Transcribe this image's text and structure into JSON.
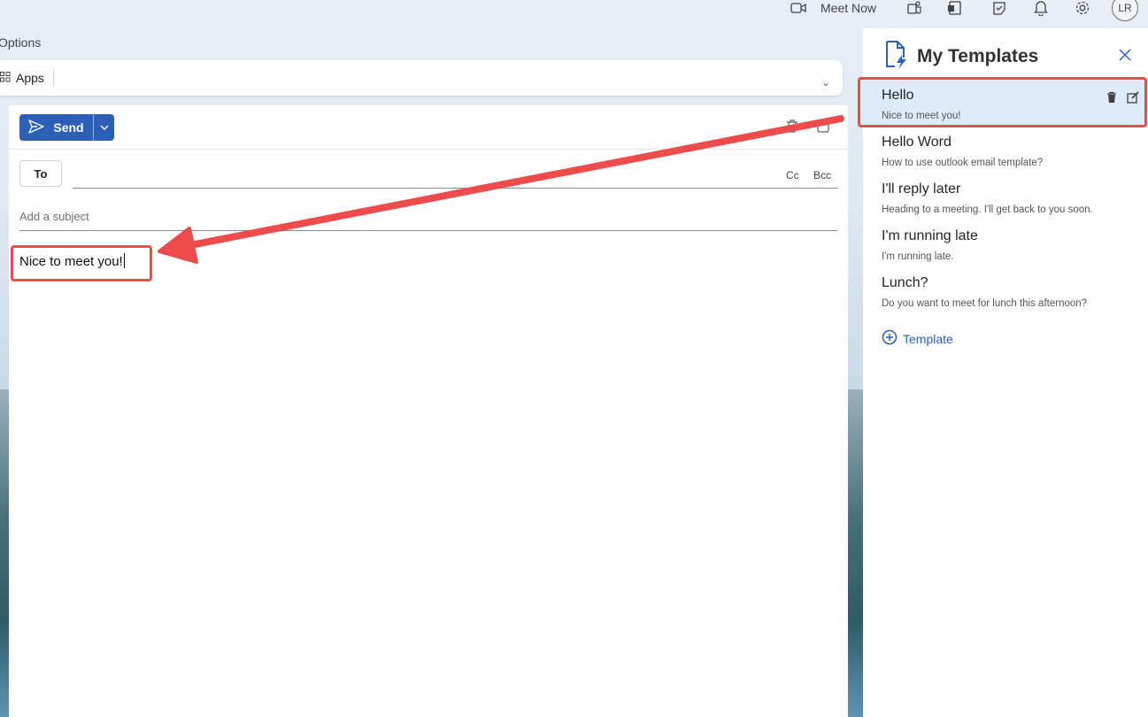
{
  "topbar": {
    "meet_now_label": "Meet Now",
    "avatar_initials": "LR",
    "icons": [
      "video-icon",
      "teams-icon",
      "onenote-icon",
      "todo-icon",
      "bell-icon",
      "gear-icon"
    ]
  },
  "ribbon": {
    "tab_label": "Options",
    "apps_label": "Apps"
  },
  "compose": {
    "send_label": "Send",
    "to_label": "To",
    "cc_label": "Cc",
    "bcc_label": "Bcc",
    "subject_placeholder": "Add a subject",
    "body_text": "Nice to meet you!"
  },
  "templates_pane": {
    "title": "My Templates",
    "items": [
      {
        "title": "Hello",
        "body": "Nice to meet you!",
        "selected": true
      },
      {
        "title": "Hello Word",
        "body": "How to use outlook email template?"
      },
      {
        "title": "I'll reply later",
        "body": "Heading to a meeting. I'll get back to you soon."
      },
      {
        "title": "I'm running late",
        "body": "I'm running late."
      },
      {
        "title": "Lunch?",
        "body": "Do you want to meet for lunch this afternoon?"
      }
    ],
    "add_label": "Template"
  },
  "colors": {
    "accent": "#2b5fb8",
    "annotation_red": "#ee4c4c",
    "selected_row": "#deebf8"
  }
}
